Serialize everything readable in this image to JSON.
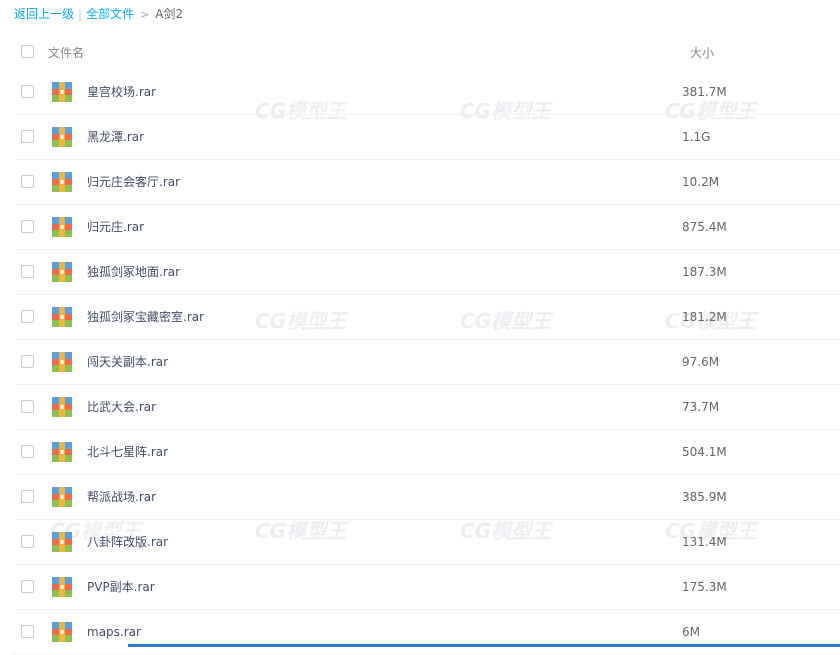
{
  "breadcrumb": {
    "back_label": "返回上一级",
    "separator": "|",
    "root_label": "全部文件",
    "arrow": ">",
    "current_label": "A剑2"
  },
  "header": {
    "name_label": "文件名",
    "size_label": "大小"
  },
  "files": [
    {
      "name": "皇宫校场.rar",
      "size": "381.7M"
    },
    {
      "name": "黑龙潭.rar",
      "size": "1.1G"
    },
    {
      "name": "归元庄会客厅.rar",
      "size": "10.2M"
    },
    {
      "name": "归元庄.rar",
      "size": "875.4M"
    },
    {
      "name": "独孤剑冢地面.rar",
      "size": "187.3M"
    },
    {
      "name": "独孤剑冢宝藏密室.rar",
      "size": "181.2M"
    },
    {
      "name": "闯天关副本.rar",
      "size": "97.6M"
    },
    {
      "name": "比武大会.rar",
      "size": "73.7M"
    },
    {
      "name": "北斗七星阵.rar",
      "size": "504.1M"
    },
    {
      "name": "帮派战场.rar",
      "size": "385.9M"
    },
    {
      "name": "八卦阵改版.rar",
      "size": "131.4M"
    },
    {
      "name": "PVP副本.rar",
      "size": "175.3M"
    },
    {
      "name": "maps.rar",
      "size": "6M"
    }
  ],
  "watermark_text": "CG模型王",
  "colors": {
    "link": "#09aaff",
    "text": "#424e67",
    "scrollbar": "#2e7bd6"
  }
}
